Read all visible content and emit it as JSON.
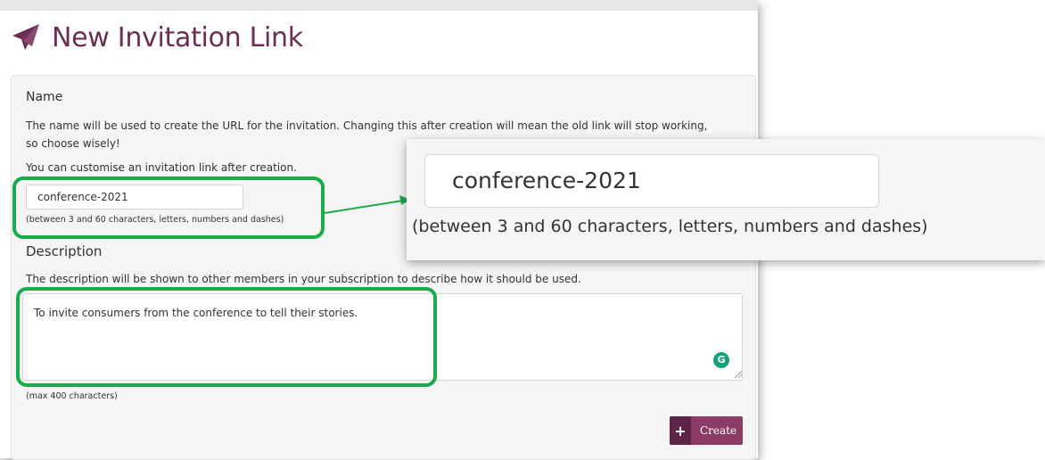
{
  "page": {
    "title": "New Invitation Link",
    "title_icon": "paper-plane-icon",
    "accent_color": "#6b2d52",
    "highlight_color": "#1aab4b"
  },
  "name_section": {
    "heading": "Name",
    "help_line1": "The name will be used to create the URL for the invitation. Changing this after creation will mean the old link will stop working,",
    "help_line2": "so choose wisely!",
    "help_line3": "You can customise an invitation link after creation.",
    "input_value": "conference-2021",
    "input_hint": "(between 3 and 60 characters, letters, numbers and dashes)"
  },
  "description_section": {
    "heading": "Description",
    "help": "The description will be shown to other members in your subscription to describe how it should be used.",
    "textarea_value": "To invite consumers from the conference to tell their stories.",
    "hint": "(max 400 characters)",
    "grammarly_icon": "grammarly-icon",
    "grammarly_label": "G"
  },
  "actions": {
    "create_label": "Create",
    "create_icon": "plus-icon"
  },
  "zoom_callout": {
    "input_value": "conference-2021",
    "input_hint": "(between 3 and 60 characters, letters, numbers and dashes)"
  }
}
